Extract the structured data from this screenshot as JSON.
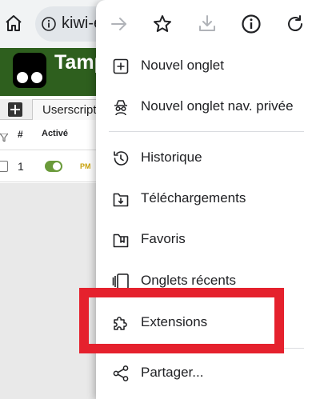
{
  "browser": {
    "url_text": "kiwi-e",
    "home_icon": "home-icon",
    "info_icon": "info-icon"
  },
  "tampermonkey": {
    "title": "Tamp",
    "tab_label": "Userscript",
    "columns": {
      "number": "#",
      "active": "Activé"
    },
    "rows": [
      {
        "number": "1",
        "active": true,
        "icon_text": "PM"
      }
    ],
    "colors": {
      "header_bg": "#2e5f1e",
      "toggle_on": "#6a9a3a"
    }
  },
  "menu": {
    "top_icons": [
      "forward-icon",
      "star-icon",
      "download-icon",
      "info-icon",
      "refresh-icon"
    ],
    "items": [
      {
        "label": "Nouvel onglet",
        "icon": "new-tab-icon"
      },
      {
        "label": "Nouvel onglet nav. privée",
        "icon": "incognito-icon"
      },
      {
        "label": "Historique",
        "icon": "history-icon"
      },
      {
        "label": "Téléchargements",
        "icon": "downloads-icon"
      },
      {
        "label": "Favoris",
        "icon": "bookmarks-icon"
      },
      {
        "label": "Onglets récents",
        "icon": "recent-tabs-icon"
      },
      {
        "label": "Extensions",
        "icon": "extensions-icon"
      },
      {
        "label": "Partager...",
        "icon": "share-icon"
      }
    ],
    "highlighted_item": "Extensions",
    "highlight_color": "#e5212d"
  }
}
